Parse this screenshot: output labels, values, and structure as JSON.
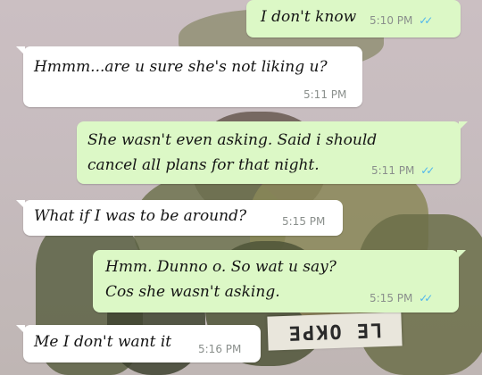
{
  "chat": {
    "messages": [
      {
        "direction": "outgoing",
        "text": [
          "I don't know"
        ],
        "time": "5:10 PM",
        "status": "read"
      },
      {
        "direction": "incoming",
        "text": [
          "Hmmm...are u sure she's not liking u?"
        ],
        "time": "5:11 PM"
      },
      {
        "direction": "outgoing",
        "text": [
          "She wasn't even asking. Said i should",
          "cancel all plans for that night."
        ],
        "time": "5:11 PM",
        "status": "read"
      },
      {
        "direction": "incoming",
        "text": [
          "What if I was to be around?"
        ],
        "time": "5:15 PM"
      },
      {
        "direction": "outgoing",
        "text": [
          "Hmm. Dunno o. So wat u say?",
          "Cos she wasn't asking."
        ],
        "time": "5:15 PM",
        "status": "read"
      },
      {
        "direction": "incoming",
        "text": [
          "Me I don't want it"
        ],
        "time": "5:16 PM"
      }
    ],
    "read_ticks": "✓✓"
  },
  "wallpaper": {
    "nametag_text": "LE OKPE"
  },
  "colors": {
    "outgoing_bubble": "#dcf8c6",
    "incoming_bubble": "#ffffff",
    "read_ticks": "#4fb6ec",
    "timestamp": "#8a8f8c"
  }
}
